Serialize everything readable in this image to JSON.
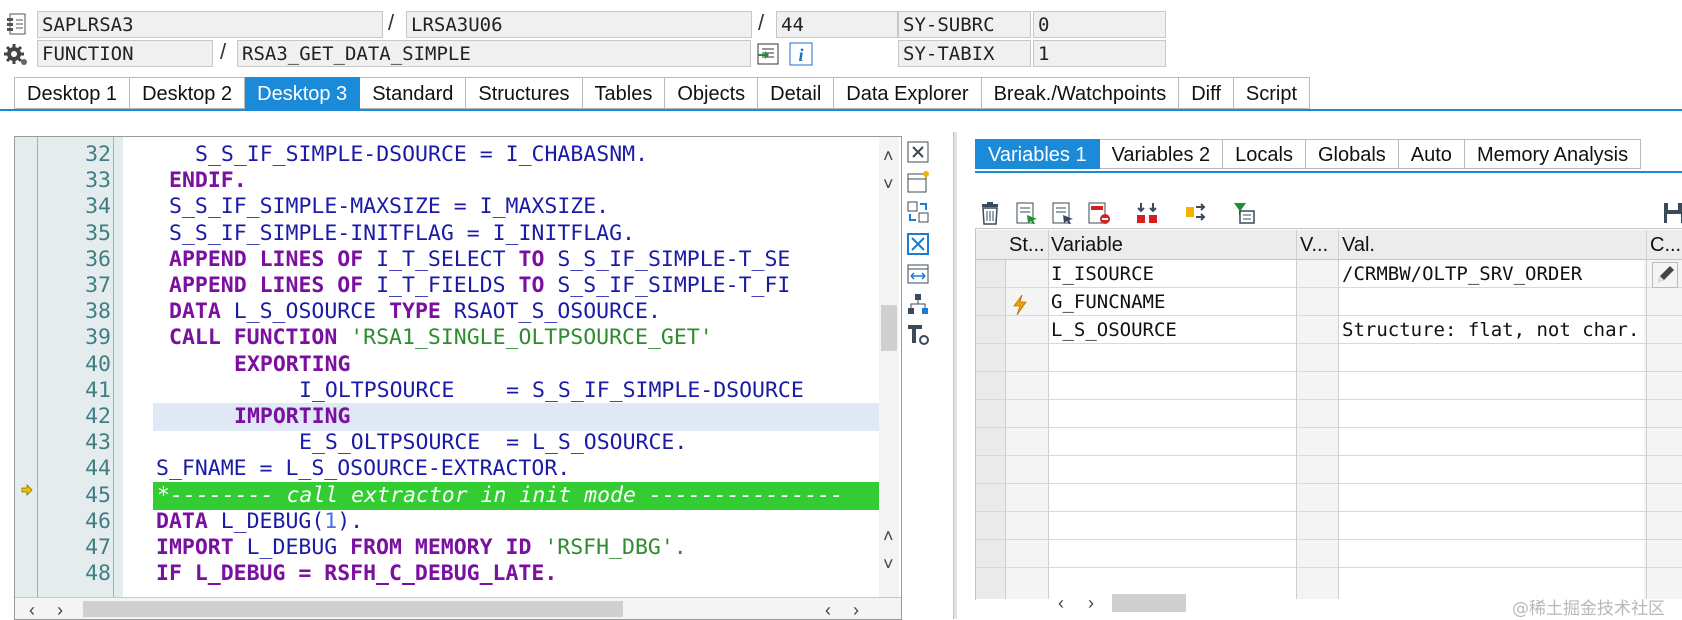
{
  "header": {
    "row1": {
      "program": "SAPLRSA3",
      "include": "LRSA3U06",
      "line": "44",
      "sysvar_name": "SY-SUBRC",
      "sysvar_value": "0"
    },
    "row2": {
      "event_type": "FUNCTION",
      "event_name": "RSA3_GET_DATA_SIMPLE",
      "sysvar_name": "SY-TABIX",
      "sysvar_value": "1"
    },
    "sep": "/"
  },
  "main_tabs": [
    "Desktop 1",
    "Desktop 2",
    "Desktop 3",
    "Standard",
    "Structures",
    "Tables",
    "Objects",
    "Detail",
    "Data Explorer",
    "Break./Watchpoints",
    "Diff",
    "Script"
  ],
  "main_tabs_active": "Desktop 3",
  "code": {
    "lines": [
      {
        "n": "32",
        "indent": "    "
      },
      {
        "n": "33",
        "indent": "  "
      },
      {
        "n": "34",
        "indent": "  "
      },
      {
        "n": "35",
        "indent": "  "
      },
      {
        "n": "36",
        "indent": "  "
      },
      {
        "n": "37",
        "indent": "  "
      },
      {
        "n": "38",
        "indent": "  "
      },
      {
        "n": "39",
        "indent": "  "
      },
      {
        "n": "40",
        "indent": "       "
      },
      {
        "n": "41",
        "indent": "            "
      },
      {
        "n": "42",
        "indent": "       "
      },
      {
        "n": "43",
        "indent": "            "
      },
      {
        "n": "44",
        "indent": " "
      },
      {
        "n": "45",
        "indent": ""
      },
      {
        "n": "46",
        "indent": " "
      },
      {
        "n": "47",
        "indent": " "
      },
      {
        "n": "48",
        "indent": " "
      }
    ],
    "text": {
      "l32": "S_S_IF_SIMPLE-DSOURCE = I_CHABASNM.",
      "l33": "ENDIF.",
      "l34": "S_S_IF_SIMPLE-MAXSIZE = I_MAXSIZE.",
      "l35": "S_S_IF_SIMPLE-INITFLAG = I_INITFLAG.",
      "l36_kw1": "APPEND LINES OF",
      "l36_a": " I_T_SELECT ",
      "l36_kw2": "TO",
      "l36_b": " S_S_IF_SIMPLE-T_SE",
      "l37_kw1": "APPEND LINES OF",
      "l37_a": " I_T_FIELDS ",
      "l37_kw2": "TO",
      "l37_b": " S_S_IF_SIMPLE-T_FI",
      "l38_kw1": "DATA",
      "l38_a": " L_S_OSOURCE ",
      "l38_kw2": "TYPE",
      "l38_b": " RSAOT_S_OSOURCE.",
      "l39_kw": "CALL FUNCTION",
      "l39_str": " 'RSA1_SINGLE_OLTPSOURCE_GET'",
      "l40_kw": "EXPORTING",
      "l41": "I_OLTPSOURCE    = S_S_IF_SIMPLE-DSOURCE",
      "l42_kw": "IMPORTING",
      "l43": "E_S_OLTPSOURCE  = L_S_OSOURCE.",
      "l44": "S_FNAME = L_S_OSOURCE-EXTRACTOR.",
      "l45": "*-------- call extractor in init mode ---------------",
      "l46_kw": "DATA",
      "l46_a": " L_DEBUG(",
      "l46_num": "1",
      "l46_b": ").",
      "l47_kw1": "IMPORT",
      "l47_a": " L_DEBUG ",
      "l47_kw2": "FROM MEMORY ID",
      "l47_str": " 'RSFH_DBG'.",
      "l48": "IF L_DEBUG = RSFH_C_DEBUG_LATE."
    }
  },
  "var_tabs": [
    "Variables 1",
    "Variables 2",
    "Locals",
    "Globals",
    "Auto",
    "Memory Analysis"
  ],
  "var_tabs_active": "Variables 1",
  "grid": {
    "headers": {
      "status": "St...",
      "variable": "Variable",
      "v": "V...",
      "value": "Val.",
      "c": "C..."
    },
    "rows": [
      {
        "variable": "I_ISOURCE",
        "value": "/CRMBW/OLTP_SRV_ORDER",
        "status_icon": "none"
      },
      {
        "variable": "G_FUNCNAME",
        "value": "",
        "status_icon": "lightning-icon"
      },
      {
        "variable": "L_S_OSOURCE",
        "value": "Structure: flat, not char.",
        "status_icon": "none"
      }
    ],
    "empty_rows": 8
  },
  "colors": {
    "accent": "#1b8ad8",
    "keyword": "#7a0fa0",
    "string": "#2e8b2e",
    "comment_bg": "#33cc33",
    "code_text": "#1a1aa6"
  },
  "watermark": "@稀土掘金技术社区"
}
